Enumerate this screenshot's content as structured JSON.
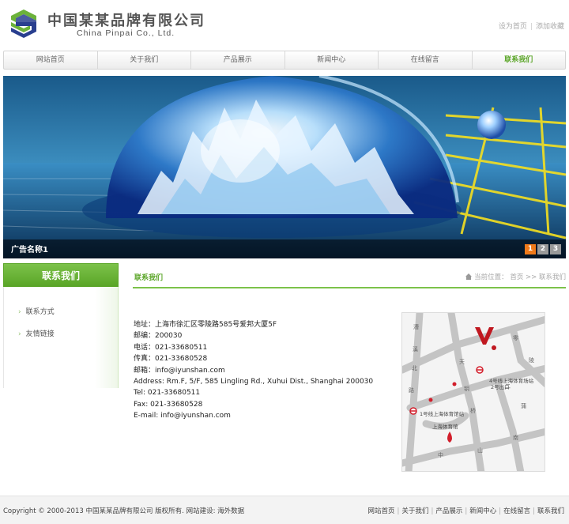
{
  "header": {
    "company_cn": "中国某某品牌有限公司",
    "company_en": "China Pinpai Co., Ltd.",
    "top_links": [
      "设为首页",
      "添加收藏"
    ]
  },
  "nav": {
    "items": [
      {
        "label": "网站首页"
      },
      {
        "label": "关于我们"
      },
      {
        "label": "产品展示"
      },
      {
        "label": "新闻中心"
      },
      {
        "label": "在线留言"
      },
      {
        "label": "联系我们",
        "active": true
      }
    ]
  },
  "banner": {
    "caption": "广告名称1",
    "pages": [
      "1",
      "2",
      "3"
    ],
    "active_page": "1"
  },
  "sidebar": {
    "title": "联系我们",
    "items": [
      {
        "label": "联系方式"
      },
      {
        "label": "友情链接"
      }
    ]
  },
  "content": {
    "title": "联系我们",
    "breadcrumb": {
      "prefix": "当前位置：",
      "home": "首页",
      "sep": ">>",
      "current": "联系我们"
    },
    "address_lines": [
      "地址：上海市徐汇区零陵路585号爱邦大厦5F",
      "邮编：200030",
      "电话：021-33680511",
      "传真：021-33680528",
      "邮箱：info@iyunshan.com",
      "Address: Rm.F, 5/F, 585 Lingling Rd., Xuhui Dist., Shanghai 200030",
      "Tel: 021-33680511",
      "Fax: 021-33680528",
      "E-mail: info@iyunshan.com"
    ]
  },
  "map": {
    "labels": {
      "metro_4": "4号线上海体育场站",
      "exit": "2号出口",
      "metro_1": "1号线上海体育馆站",
      "gym": "上海体育馆",
      "road_a": "漕",
      "road_b": "溪",
      "road_c": "北",
      "road_d": "路",
      "road_e": "天",
      "road_f": "钥",
      "road_g": "桥",
      "road_h": "中",
      "road_i": "山",
      "road_j": "南",
      "road_k": "二",
      "road_l": "零",
      "road_m": "陵",
      "road_n": "蒲"
    }
  },
  "footer": {
    "copyright": "Copyright © 2000-2013 中国某某品牌有限公司 版权所有.  网站建设: 海外数据",
    "links": [
      "网站首页",
      "关于我们",
      "产品展示",
      "新闻中心",
      "在线留言",
      "联系我们"
    ]
  },
  "colors": {
    "accent": "#5aa527",
    "active_dot": "#f07a1a"
  }
}
